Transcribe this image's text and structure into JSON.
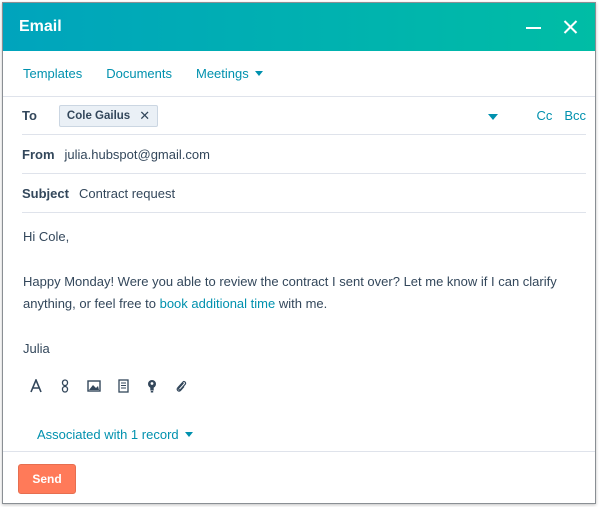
{
  "window": {
    "title": "Email"
  },
  "tabs": [
    {
      "label": "Templates"
    },
    {
      "label": "Documents"
    },
    {
      "label": "Meetings"
    }
  ],
  "to": {
    "label": "To",
    "recipient": "Cole Gailus",
    "remove": "✕",
    "cc": "Cc",
    "bcc": "Bcc"
  },
  "from": {
    "label": "From",
    "value": "julia.hubspot@gmail.com"
  },
  "subject": {
    "label": "Subject",
    "value": "Contract request"
  },
  "message": {
    "greeting": "Hi Cole,",
    "para_before": "Happy Monday! Were you able to review the contract I sent over? Let me know if I can clarify anything, or feel free to ",
    "link": "book additional time",
    "para_after": " with me.",
    "signoff": "Julia"
  },
  "format_icons": [
    "text-style-icon",
    "link-icon",
    "image-icon",
    "document-icon",
    "lightbulb-icon",
    "attachment-icon"
  ],
  "associated": {
    "label": "Associated with 1 record"
  },
  "footer": {
    "send_label": "Send"
  },
  "colors": {
    "header_start": "#00a4bd",
    "header_end": "#00bda5",
    "link": "#0091ae",
    "send": "#ff7a59",
    "text": "#33475b"
  }
}
